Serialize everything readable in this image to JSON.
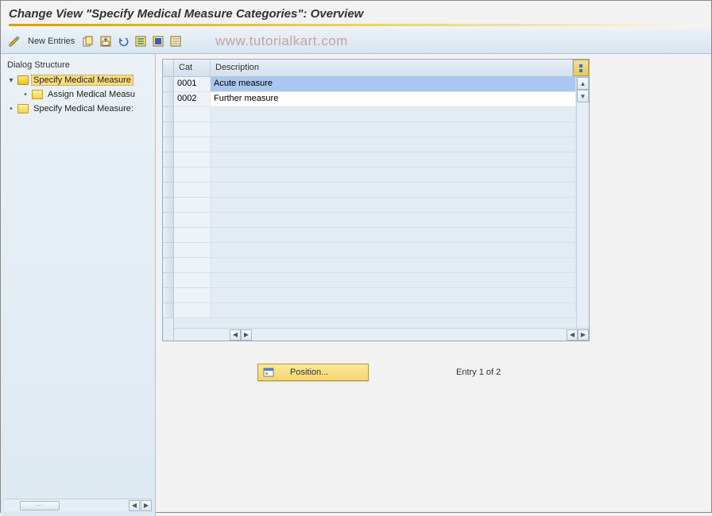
{
  "title": "Change View \"Specify Medical Measure Categories\": Overview",
  "toolbar": {
    "new_entries": "New Entries"
  },
  "watermark": "www.tutorialkart.com",
  "sidebar": {
    "title": "Dialog Structure",
    "items": [
      {
        "label": "Specify Medical Measure",
        "expanded": true,
        "selected": true,
        "open": true
      },
      {
        "label": "Assign Medical Measu",
        "expanded": false,
        "selected": false,
        "open": false,
        "child": true
      },
      {
        "label": "Specify Medical Measure:",
        "expanded": false,
        "selected": false,
        "open": false
      }
    ]
  },
  "grid": {
    "headers": {
      "cat": "Cat",
      "desc": "Description"
    },
    "rows": [
      {
        "cat": "0001",
        "desc": "Acute measure",
        "selected": true
      },
      {
        "cat": "0002",
        "desc": "Further measure",
        "selected": false
      }
    ],
    "empty_rows": 14
  },
  "footer": {
    "position": "Position...",
    "entry_text": "Entry 1 of 2"
  }
}
